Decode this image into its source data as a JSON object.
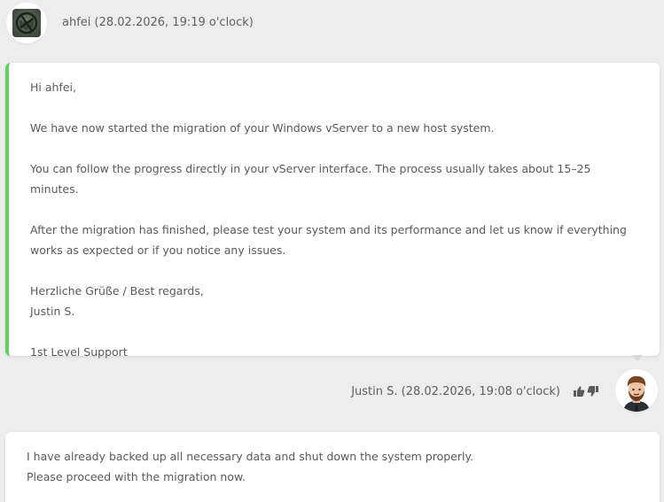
{
  "header_customer": {
    "author": "ahfei (28.02.2026, 19:19 o'clock)",
    "avatar_icon": "windows-server-avatar-icon"
  },
  "support_message": {
    "paragraphs": [
      "Hi ahfei,",
      "We have now started the migration of your Windows vServer to a new host system.",
      "You can follow the progress directly in your vServer interface. The process usually takes about 15–25 minutes.",
      "After the migration has finished, please test your system and its performance and let us know if everything works as expected or if you notice any issues.",
      "Herzliche Grüße / Best regards,\nJustin S.",
      "1st Level Support"
    ],
    "accent_color": "#5fd35f"
  },
  "header_agent": {
    "author": "Justin S. (28.02.2026, 19:08 o'clock)",
    "thumbs_up_icon": "thumbs-up-icon",
    "thumbs_down_icon": "thumbs-down-icon",
    "avatar_icon": "agent-avatar-icon"
  },
  "customer_message": {
    "lines": "I have already backed up all necessary data and shut down the system properly.\nPlease proceed with the migration now."
  }
}
